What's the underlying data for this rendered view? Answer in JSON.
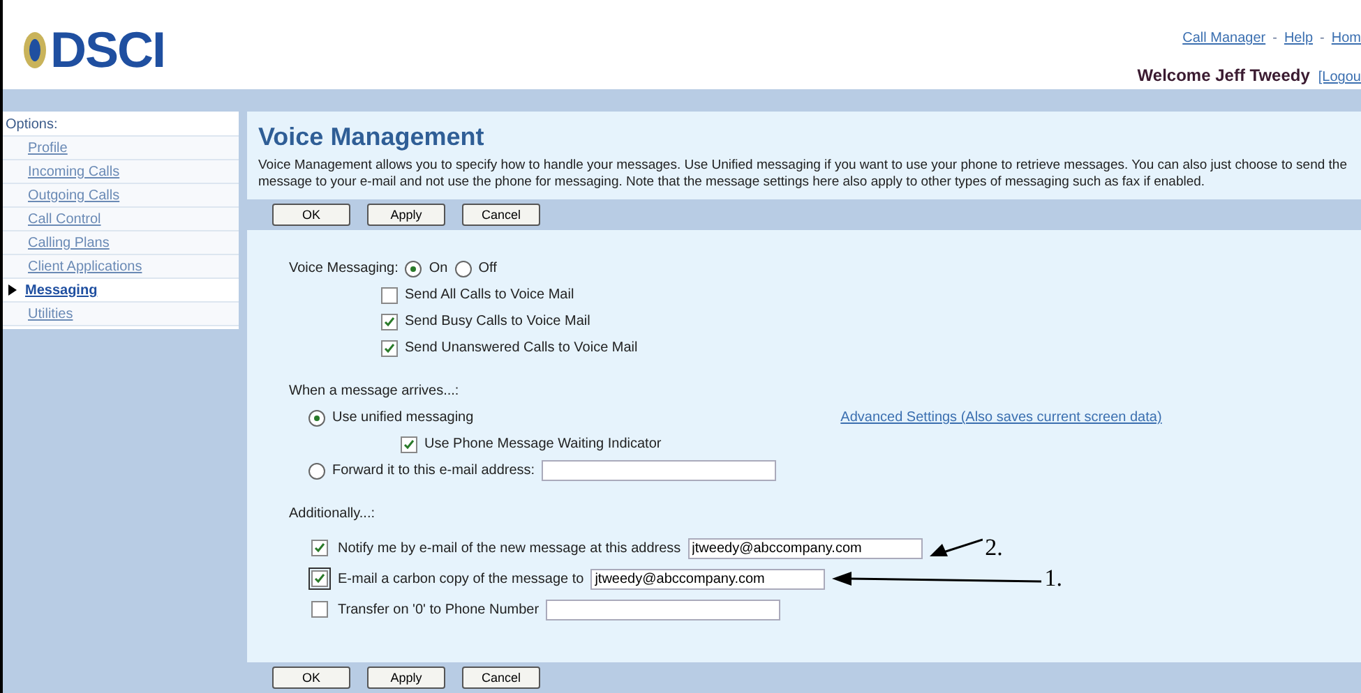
{
  "header": {
    "logo": "DSCI",
    "nav_links": [
      {
        "label": "Call Manager"
      },
      {
        "label": "Help"
      },
      {
        "label": "Hom"
      }
    ],
    "separator": "-",
    "welcome": "Welcome Jeff Tweedy",
    "logout": "[Logou"
  },
  "sidebar": {
    "heading": "Options:",
    "items": [
      {
        "label": "Profile",
        "selected": false
      },
      {
        "label": "Incoming Calls",
        "selected": false
      },
      {
        "label": "Outgoing Calls",
        "selected": false
      },
      {
        "label": "Call Control",
        "selected": false
      },
      {
        "label": "Calling Plans",
        "selected": false
      },
      {
        "label": "Client Applications",
        "selected": false
      },
      {
        "label": "Messaging",
        "selected": true
      },
      {
        "label": "Utilities",
        "selected": false
      }
    ]
  },
  "main": {
    "title": "Voice Management",
    "description": "Voice Management allows you to specify how to handle your messages. Use Unified messaging if you want to use your phone to retrieve messages. You can also just choose to send the message to your e-mail and not use the phone for messaging. Note that the message settings here also apply to other types of messaging such as fax if enabled.",
    "buttons": [
      {
        "label": "OK"
      },
      {
        "label": "Apply"
      },
      {
        "label": "Cancel"
      }
    ],
    "voice_messaging": {
      "label": "Voice Messaging:",
      "options": [
        {
          "label": "On",
          "selected": true
        },
        {
          "label": "Off",
          "selected": false
        }
      ],
      "checkboxes": [
        {
          "label": "Send All Calls to Voice Mail",
          "checked": false
        },
        {
          "label": "Send Busy Calls to Voice Mail",
          "checked": true
        },
        {
          "label": "Send Unanswered Calls to Voice Mail",
          "checked": true
        }
      ]
    },
    "arrival": {
      "heading": "When a message arrives...:",
      "unified": {
        "label": "Use unified messaging",
        "selected": true,
        "indicator": {
          "label": "Use Phone Message Waiting Indicator",
          "checked": true
        },
        "link": "Advanced Settings (Also saves current screen data)"
      },
      "forward": {
        "label": "Forward it to this e-mail address:",
        "selected": false
      }
    },
    "additionally": {
      "heading": "Additionally...:",
      "rows": [
        {
          "label": "Notify me by e-mail of the new message at this address",
          "checked": true,
          "focused": false,
          "value": "jtweedy@abccompany.com",
          "callout": {
            "label": "2.",
            "kind": "short"
          }
        },
        {
          "label": "E-mail a carbon copy of the message to",
          "checked": true,
          "focused": true,
          "value": "jtweedy@abccompany.com",
          "callout": {
            "label": "1.",
            "kind": "long"
          }
        },
        {
          "label": "Transfer on '0' to Phone Number",
          "checked": false,
          "focused": false
        }
      ]
    },
    "bottom_buttons": [
      {
        "label": "OK"
      },
      {
        "label": "Apply"
      },
      {
        "label": "Cancel"
      }
    ]
  }
}
